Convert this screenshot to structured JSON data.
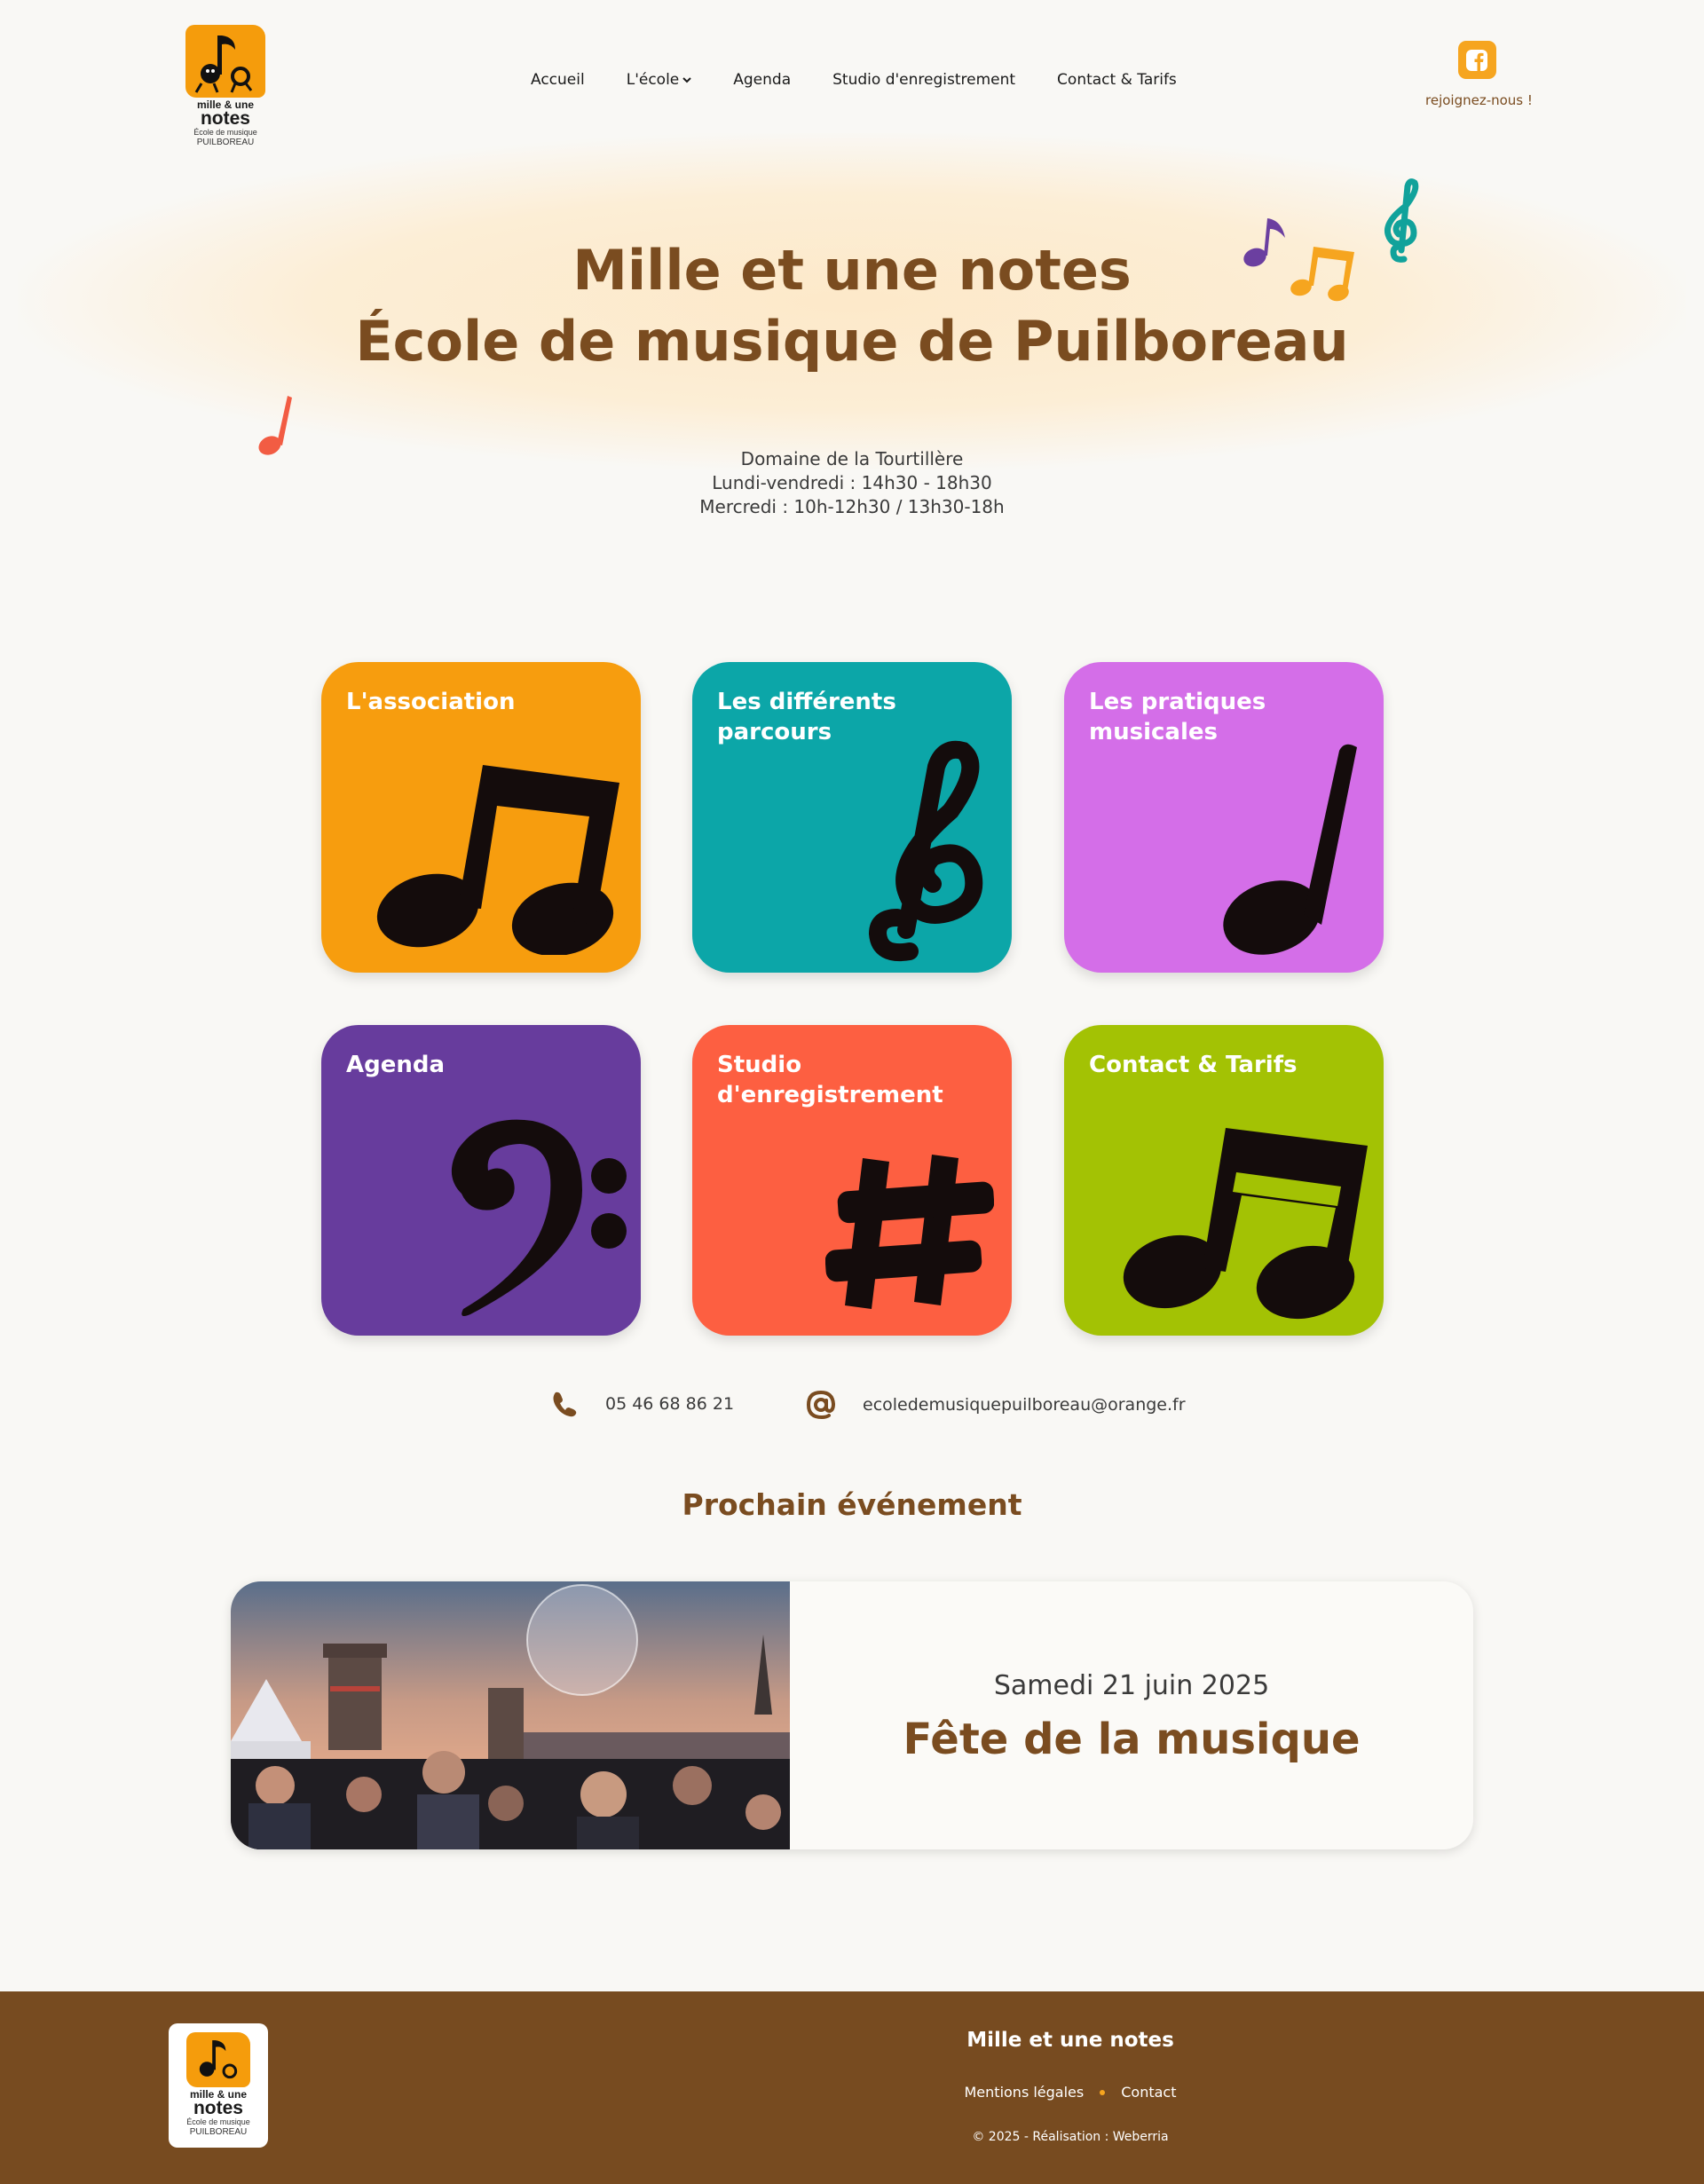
{
  "header": {
    "logo": {
      "line1": "mille & une",
      "line2": "notes",
      "line3": "École de musique",
      "line4": "PUILBOREAU"
    },
    "nav": [
      {
        "label": "Accueil"
      },
      {
        "label": "L'école",
        "has_dropdown": true
      },
      {
        "label": "Agenda"
      },
      {
        "label": "Studio d'enregistrement"
      },
      {
        "label": "Contact & Tarifs"
      }
    ],
    "social": {
      "icon": "facebook-icon",
      "caption": "rejoignez-nous !"
    }
  },
  "hero": {
    "title_line1": "Mille et une notes",
    "title_line2": "École de musique de Puilboreau",
    "info": [
      "Domaine de la Tourtillère",
      "Lundi-vendredi : 14h30 - 18h30",
      "Mercredi : 10h-12h30 / 13h30-18h"
    ]
  },
  "cards": [
    {
      "label": "L'association",
      "color": "#f79d0e",
      "icon": "beamed-eighth-notes-icon"
    },
    {
      "label": "Les différents parcours",
      "color": "#0ca6a8",
      "icon": "treble-clef-icon"
    },
    {
      "label": "Les pratiques musicales",
      "color": "#d46ee8",
      "icon": "quarter-note-icon"
    },
    {
      "label": "Agenda",
      "color": "#673c9d",
      "icon": "bass-clef-icon"
    },
    {
      "label": "Studio d'enregistrement",
      "color": "#fd5f41",
      "icon": "sharp-icon"
    },
    {
      "label": "Contact & Tarifs",
      "color": "#a3c204",
      "icon": "beamed-sixteenth-notes-icon"
    }
  ],
  "contact": {
    "phone": "05 46 68 86 21",
    "email": "ecoledemusiquepuilboreau@orange.fr"
  },
  "next_event": {
    "section_title": "Prochain événement",
    "date": "Samedi 21 juin 2025",
    "name": "Fête de la musique"
  },
  "footer": {
    "title": "Mille et une notes",
    "links": [
      "Mentions légales",
      "Contact"
    ],
    "copyright": "© 2025 - Réalisation : Weberria"
  },
  "colors": {
    "brand_brown": "#7a4c20",
    "accent_orange": "#f6a51f",
    "footer_bg": "#774b20",
    "page_bg": "#f9f8f5"
  }
}
